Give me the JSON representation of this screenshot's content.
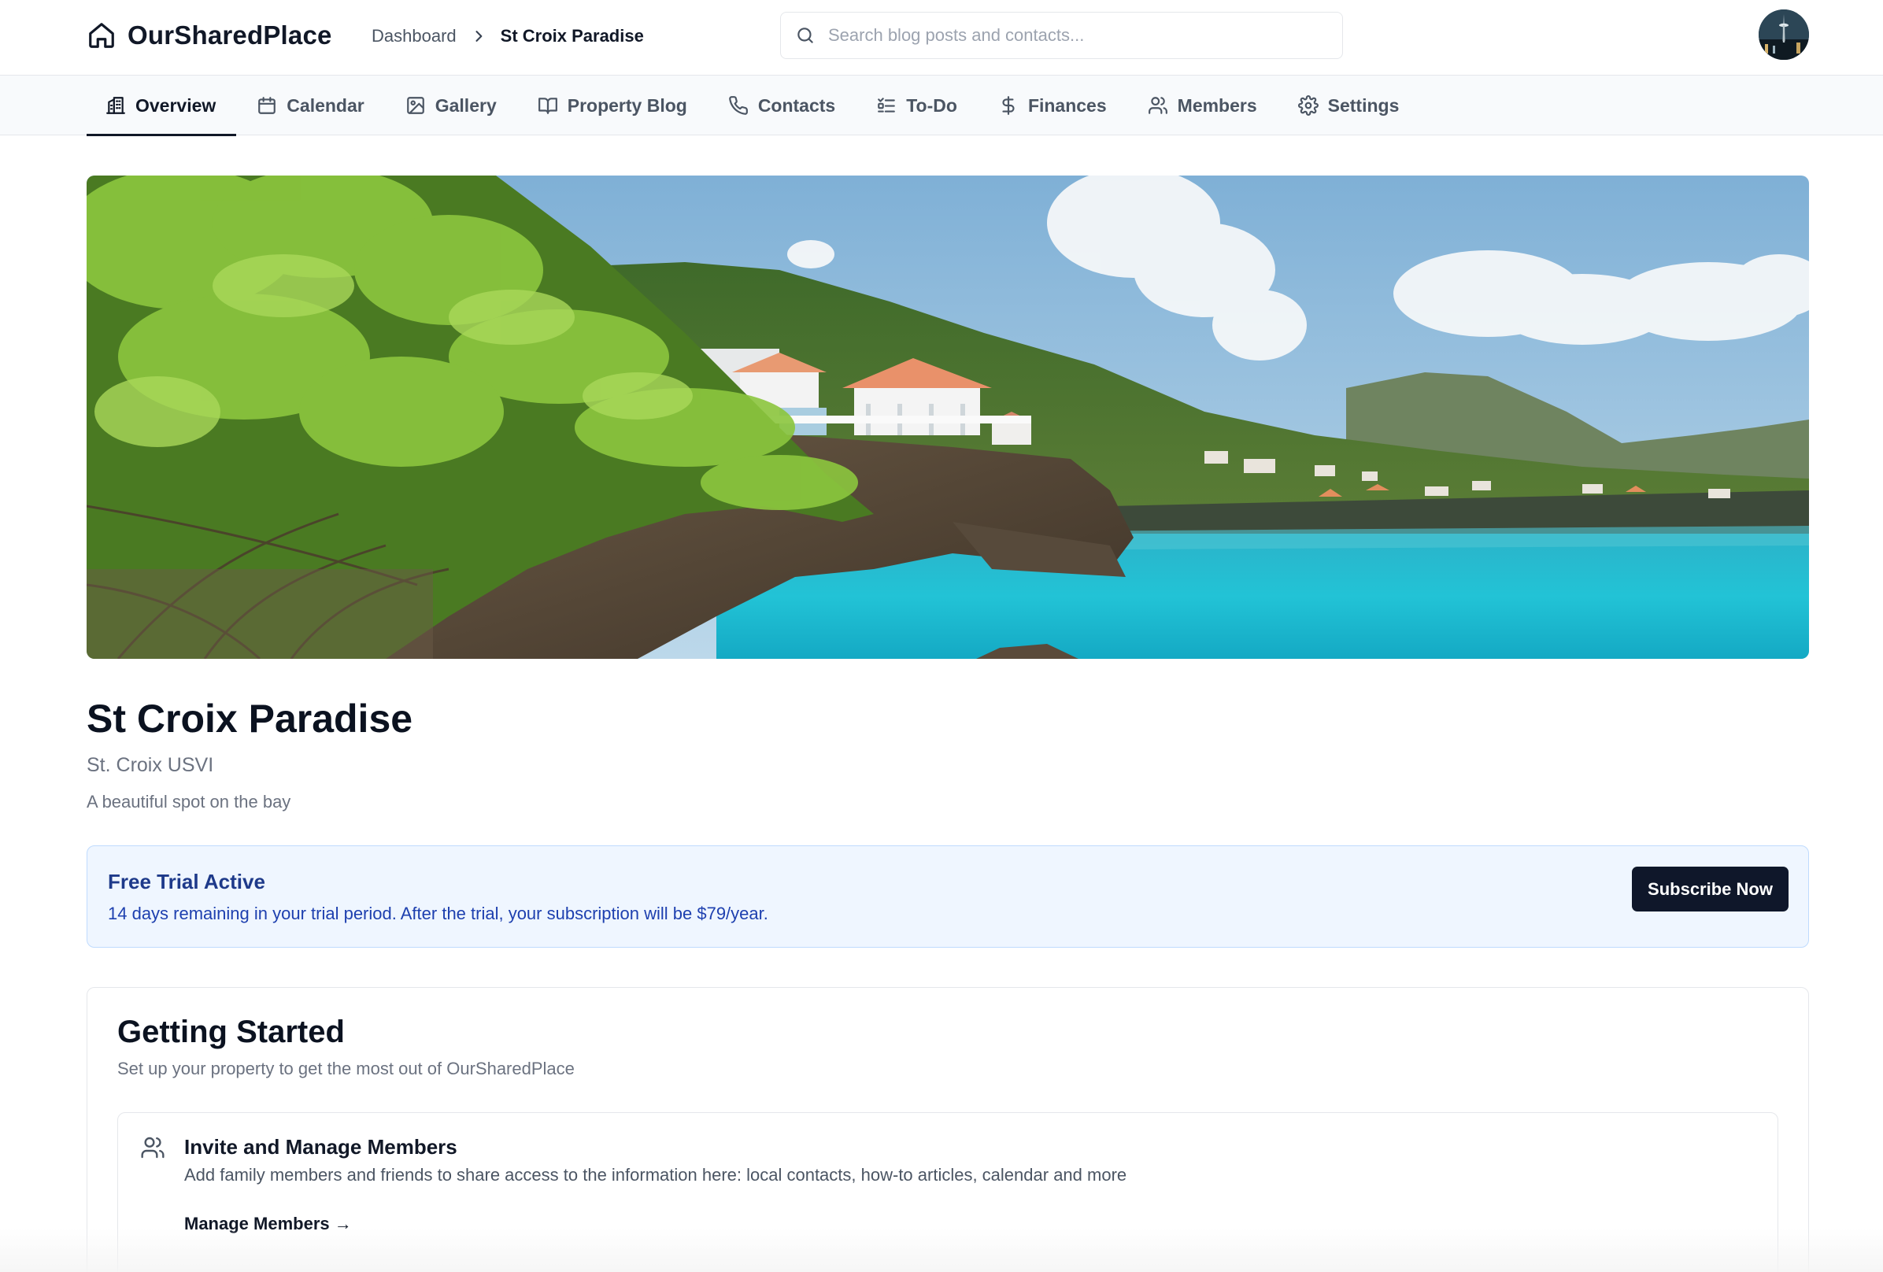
{
  "app": {
    "name": "OurSharedPlace",
    "logo_icon": "home-icon"
  },
  "breadcrumb": {
    "root": "Dashboard",
    "separator_icon": "chevron-right-icon",
    "current": "St Croix Paradise"
  },
  "search": {
    "placeholder": "Search blog posts and contacts...",
    "value": "",
    "icon": "search-icon"
  },
  "user": {
    "avatar_icon": "user-avatar"
  },
  "tabs": [
    {
      "label": "Overview",
      "icon": "building-icon",
      "active": true
    },
    {
      "label": "Calendar",
      "icon": "calendar-icon",
      "active": false
    },
    {
      "label": "Gallery",
      "icon": "image-icon",
      "active": false
    },
    {
      "label": "Property Blog",
      "icon": "book-icon",
      "active": false
    },
    {
      "label": "Contacts",
      "icon": "phone-icon",
      "active": false
    },
    {
      "label": "To-Do",
      "icon": "checklist-icon",
      "active": false
    },
    {
      "label": "Finances",
      "icon": "dollar-icon",
      "active": false
    },
    {
      "label": "Members",
      "icon": "users-icon",
      "active": false
    },
    {
      "label": "Settings",
      "icon": "gear-icon",
      "active": false
    }
  ],
  "property": {
    "name": "St Croix Paradise",
    "location": "St. Croix USVI",
    "description": "A beautiful spot on the bay",
    "hero_image": "coastal-villas-photo"
  },
  "trial": {
    "title": "Free Trial Active",
    "message": "14 days remaining in your trial period. After the trial, your subscription will be $79/year.",
    "cta": "Subscribe Now"
  },
  "getting_started": {
    "title": "Getting Started",
    "subtitle": "Set up your property to get the most out of OurSharedPlace",
    "items": [
      {
        "icon": "users-icon",
        "title": "Invite and Manage Members",
        "description": "Add family members and friends to share access to the information here: local contacts, how-to articles, calendar and more",
        "link": "Manage Members →"
      }
    ]
  },
  "colors": {
    "primary_dark": "#0f172a",
    "banner_bg": "#eff6ff",
    "banner_border": "#bfdbfe",
    "banner_title": "#1e3a8a",
    "muted_text": "#6b7280"
  }
}
